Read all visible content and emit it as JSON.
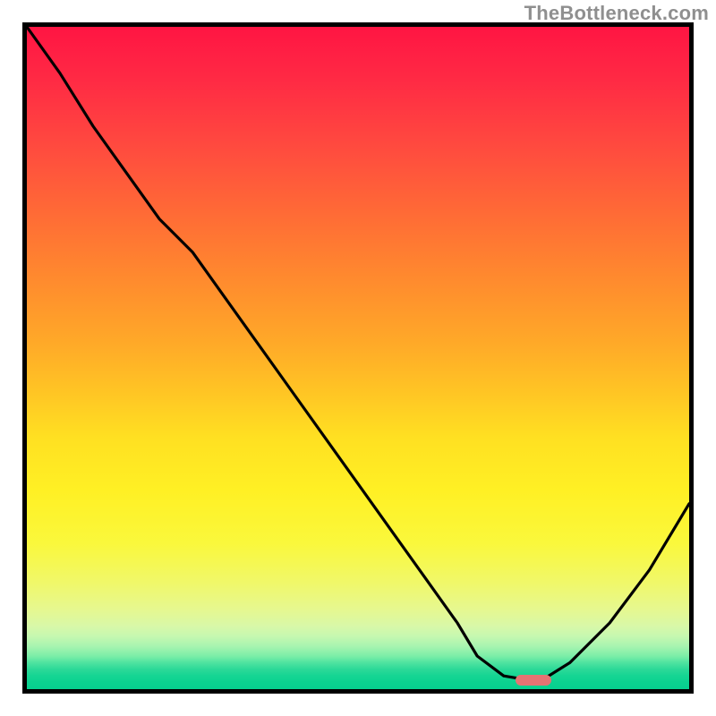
{
  "watermark": "TheBottleneck.com",
  "chart_data": {
    "type": "line",
    "title": "",
    "xlabel": "",
    "ylabel": "",
    "xlim": [
      0,
      100
    ],
    "ylim": [
      0,
      100
    ],
    "grid": false,
    "legend": false,
    "series": [
      {
        "name": "bottleneck-curve",
        "x": [
          0,
          5,
          10,
          15,
          20,
          25,
          30,
          35,
          40,
          45,
          50,
          55,
          60,
          65,
          68,
          72,
          75,
          78,
          82,
          88,
          94,
          100
        ],
        "y": [
          100,
          93,
          85,
          78,
          71,
          66,
          59,
          52,
          45,
          38,
          31,
          24,
          17,
          10,
          5,
          2,
          1.5,
          1.5,
          4,
          10,
          18,
          28
        ]
      }
    ],
    "marker": {
      "x_center": 76.5,
      "width_pct": 5.5,
      "y": 1.3
    },
    "gradient_stops": [
      {
        "pct": 0,
        "color": "#ff1543"
      },
      {
        "pct": 50,
        "color": "#ffcc22"
      },
      {
        "pct": 85,
        "color": "#f5f860"
      },
      {
        "pct": 100,
        "color": "#06d08f"
      }
    ]
  }
}
